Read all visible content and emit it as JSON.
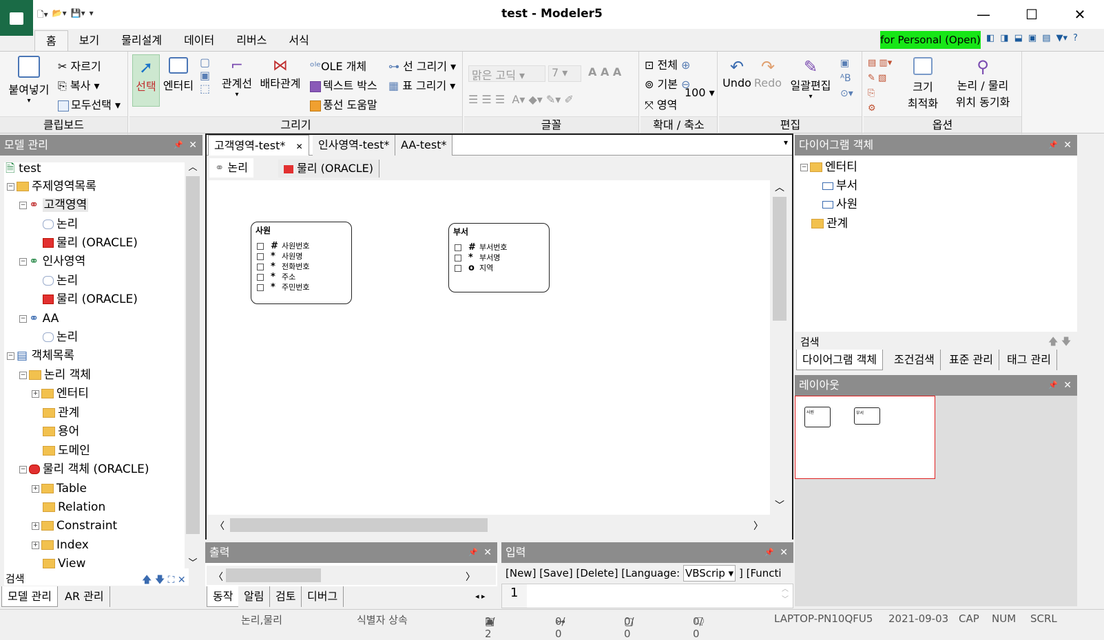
{
  "window": {
    "title": "test - Modeler5",
    "minimize": "—",
    "maximize": "☐",
    "close": "✕"
  },
  "menu": [
    "홈",
    "보기",
    "물리설계",
    "데이터",
    "리버스",
    "서식"
  ],
  "personal_badge": "for Personal (Open)",
  "ribbon": {
    "clipboard": {
      "label": "클립보드",
      "paste": "붙여넣기",
      "cut": "자르기",
      "copy": "복사",
      "select_all": "모두선택"
    },
    "draw": {
      "label": "그리기",
      "select": "선택",
      "entity": "엔터티",
      "relation_line": "관계선",
      "exclusive": "배타관계",
      "ole": "OLE 개체",
      "textbox": "텍스트 박스",
      "balloon": "풍선 도움말",
      "line_draw": "선 그리기",
      "table_draw": "표 그리기"
    },
    "font": {
      "label": "글꼴",
      "face": "맑은 고딕",
      "size": "7"
    },
    "zoom": {
      "label": "확대 / 축소",
      "all": "전체",
      "basic": "기본",
      "area": "영역",
      "percent": "100"
    },
    "edit": {
      "label": "편집",
      "undo": "Undo",
      "redo": "Redo",
      "batch": "일괄편집"
    },
    "options": {
      "label": "옵션",
      "fit_size_1": "크기",
      "fit_size_2": "최적화",
      "sync_1": "논리 / 물리",
      "sync_2": "위치 동기화"
    }
  },
  "model_panel": {
    "title": "모델 관리",
    "tree": [
      {
        "label": "test"
      },
      {
        "label": "주제영역목록"
      },
      {
        "label": "고객영역"
      },
      {
        "label": "논리"
      },
      {
        "label": "물리 (ORACLE)"
      },
      {
        "label": "인사영역"
      },
      {
        "label": "논리"
      },
      {
        "label": "물리 (ORACLE)"
      },
      {
        "label": "AA"
      },
      {
        "label": "논리"
      },
      {
        "label": "객체목록"
      },
      {
        "label": "논리 객체"
      },
      {
        "label": "엔터티"
      },
      {
        "label": "관계"
      },
      {
        "label": "용어"
      },
      {
        "label": "도메인"
      },
      {
        "label": "물리 객체 (ORACLE)"
      },
      {
        "label": "Table"
      },
      {
        "label": "Relation"
      },
      {
        "label": "Constraint"
      },
      {
        "label": "Index"
      },
      {
        "label": "View"
      }
    ],
    "search_label": "검색",
    "tabs": [
      "모델 관리",
      "AR 관리"
    ]
  },
  "doc_tabs": [
    "고객영역-test*",
    "인사영역-test*",
    "AA-test*"
  ],
  "sub_tabs": [
    "논리",
    "물리 (ORACLE)"
  ],
  "entities": [
    {
      "name": "사원",
      "attrs": [
        {
          "key": "#",
          "name": "사원번호"
        },
        {
          "key": "*",
          "name": "사원명"
        },
        {
          "key": "*",
          "name": "전화번호"
        },
        {
          "key": "*",
          "name": "주소"
        },
        {
          "key": "*",
          "name": "주민번호"
        }
      ]
    },
    {
      "name": "부서",
      "attrs": [
        {
          "key": "#",
          "name": "부서번호"
        },
        {
          "key": "*",
          "name": "부서명"
        },
        {
          "key": "o",
          "name": "지역"
        }
      ]
    }
  ],
  "diagram_panel": {
    "title": "다이어그램 객체",
    "tree": [
      {
        "label": "엔터티"
      },
      {
        "label": "부서"
      },
      {
        "label": "사원"
      },
      {
        "label": "관계"
      }
    ],
    "search_label": "검색",
    "tabs": [
      "다이어그램 객체",
      "조건검색",
      "표준 관리",
      "태그 관리"
    ]
  },
  "layout_panel": {
    "title": "레이아웃",
    "mini": [
      "사원",
      "부서"
    ]
  },
  "output_panel": {
    "title": "출력",
    "tabs": [
      "동작",
      "알림",
      "검토",
      "디버그"
    ]
  },
  "input_panel": {
    "title": "입력",
    "toolbar": "[New]  [Save]  [Delete]   [Language:",
    "language": "VBScrip",
    "func": "]  [Functi",
    "line_no": "1"
  },
  "status": {
    "mode": "논리,물리",
    "identifier": "식별자 상속",
    "c1": "2/   2",
    "c2": "0/   0",
    "c3": "0/   0",
    "c4": "0/   0",
    "host": "LAPTOP-PN10QFU5",
    "date": "2021-09-03",
    "cap": "CAP",
    "num": "NUM",
    "scrl": "SCRL"
  },
  "colors": {
    "logo": "#1a6b46",
    "badge": "#17e617",
    "panel_title": "#8c8c8c"
  }
}
